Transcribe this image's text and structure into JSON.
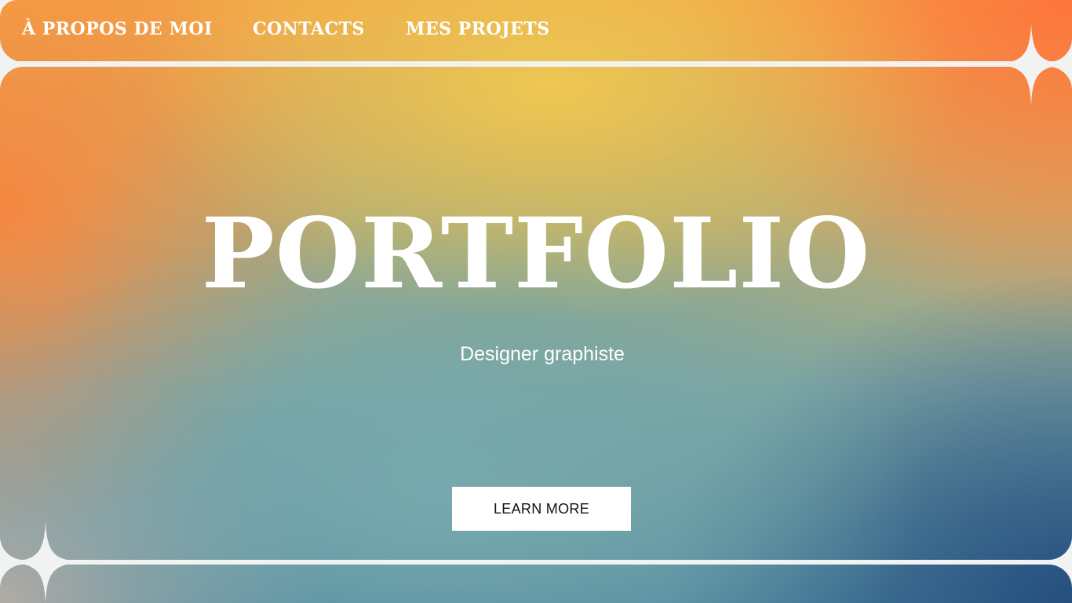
{
  "nav": {
    "items": [
      {
        "label": "À PROPOS DE MOI"
      },
      {
        "label": "CONTACTS"
      },
      {
        "label": "MES PROJETS"
      }
    ]
  },
  "hero": {
    "title": "PORTFOLIO",
    "subtitle": "Designer graphiste",
    "cta_label": "LEARN MORE"
  },
  "colors": {
    "frame": "#f1f3f2",
    "text": "#ffffff",
    "button_bg": "#ffffff",
    "button_text": "#111111",
    "gradient_warm": "#f2a547",
    "gradient_cool": "#4f88a0",
    "gradient_deep": "#234b7d"
  },
  "decorations": {
    "sparkles": [
      "four-point-star-icon",
      "four-point-star-icon"
    ]
  }
}
